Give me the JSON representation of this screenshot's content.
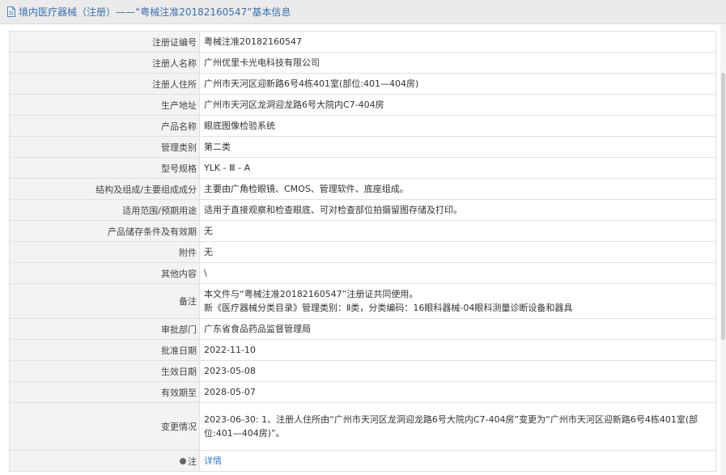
{
  "header": {
    "title": "境内医疗器械（注册）——“粤械注准20182160547”基本信息"
  },
  "rows": [
    {
      "label": "注册证编号",
      "value": "粤械注准20182160547"
    },
    {
      "label": "注册人名称",
      "value": "广州优里卡光电科技有限公司"
    },
    {
      "label": "注册人住所",
      "value": "广州市天河区迎新路6号4栋401室(部位:401—404房)"
    },
    {
      "label": "生产地址",
      "value": "广州市天河区龙洞迎龙路6号大院内C7-404房"
    },
    {
      "label": "产品名称",
      "value": "眼底图像检验系统"
    },
    {
      "label": "管理类别",
      "value": "第二类"
    },
    {
      "label": "型号规格",
      "value": "YLK - Ⅲ - A"
    },
    {
      "label": "结构及组成/主要组成成分",
      "value": "主要由广角检眼镜、CMOS、管理软件、底座组成。"
    },
    {
      "label": "适用范围/预期用途",
      "value": "适用于直接观察和检查眼底、可对检查部位拍摄留图存储及打印。"
    },
    {
      "label": "产品储存条件及有效期",
      "value": "无"
    },
    {
      "label": "附件",
      "value": "无"
    },
    {
      "label": "其他内容",
      "value": "\\"
    },
    {
      "label": "备注",
      "value_line1": "本文件与“粤械注准20182160547”注册证共同使用。",
      "value_line2": "新《医疗器械分类目录》管理类别：Ⅱ类，分类编码：16眼科器械-04眼科测量诊断设备和器具"
    },
    {
      "label": "审批部门",
      "value": "广东省食品药品监督管理局"
    },
    {
      "label": "批准日期",
      "value": "2022-11-10"
    },
    {
      "label": "生效日期",
      "value": "2023-05-08"
    },
    {
      "label": "有效期至",
      "value": "2028-05-07"
    },
    {
      "label": "变更情况",
      "value": "2023-06-30: 1、注册人住所由“广州市天河区龙洞迎龙路6号大院内C7-404房”变更为“广州市天河区迎新路6号4栋401室(部位:401—404房)”。"
    },
    {
      "label": "注",
      "value": "详情"
    }
  ]
}
